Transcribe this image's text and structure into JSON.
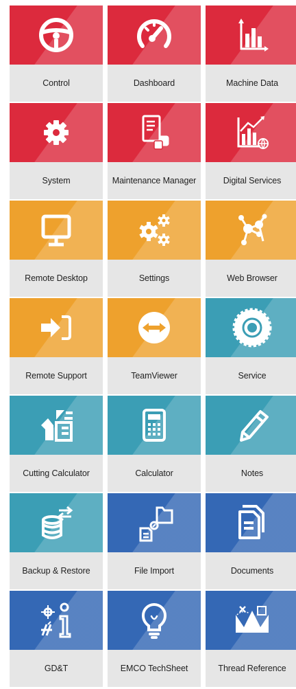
{
  "tiles": [
    {
      "label": "Control",
      "icon": "steering-wheel-icon",
      "color": "#dc2a3d"
    },
    {
      "label": "Dashboard",
      "icon": "speedometer-icon",
      "color": "#dc2a3d"
    },
    {
      "label": "Machine Data",
      "icon": "bar-chart-icon",
      "color": "#dc2a3d"
    },
    {
      "label": "System",
      "icon": "gear-icon",
      "color": "#dc2a3d"
    },
    {
      "label": "Maintenance Manager",
      "icon": "maintenance-checklist-icon",
      "color": "#dc2a3d"
    },
    {
      "label": "Digital Services",
      "icon": "digital-chart-globe-icon",
      "color": "#dc2a3d"
    },
    {
      "label": "Remote Desktop",
      "icon": "monitor-icon",
      "color": "#eea12d"
    },
    {
      "label": "Settings",
      "icon": "gears-icon",
      "color": "#eea12d"
    },
    {
      "label": "Web Browser",
      "icon": "network-nodes-icon",
      "color": "#eea12d"
    },
    {
      "label": "Remote Support",
      "icon": "sign-in-arrow-icon",
      "color": "#eea12d"
    },
    {
      "label": "TeamViewer",
      "icon": "teamviewer-icon",
      "color": "#eea12d"
    },
    {
      "label": "Service",
      "icon": "cog-wheel-icon",
      "color": "#3b9eb5"
    },
    {
      "label": "Cutting Calculator",
      "icon": "cutting-tool-icon",
      "color": "#3b9eb5"
    },
    {
      "label": "Calculator",
      "icon": "calculator-icon",
      "color": "#3b9eb5"
    },
    {
      "label": "Notes",
      "icon": "pencil-icon",
      "color": "#3b9eb5"
    },
    {
      "label": "Backup & Restore",
      "icon": "database-sync-icon",
      "color": "#3b9eb5"
    },
    {
      "label": "File Import",
      "icon": "file-import-icon",
      "color": "#3468b5"
    },
    {
      "label": "Documents",
      "icon": "documents-icon",
      "color": "#3468b5"
    },
    {
      "label": "GD&T",
      "icon": "gdt-info-icon",
      "color": "#3468b5"
    },
    {
      "label": "EMCO TechSheet",
      "icon": "lightbulb-icon",
      "color": "#3468b5"
    },
    {
      "label": "Thread Reference",
      "icon": "thread-profile-icon",
      "color": "#3468b5"
    }
  ]
}
